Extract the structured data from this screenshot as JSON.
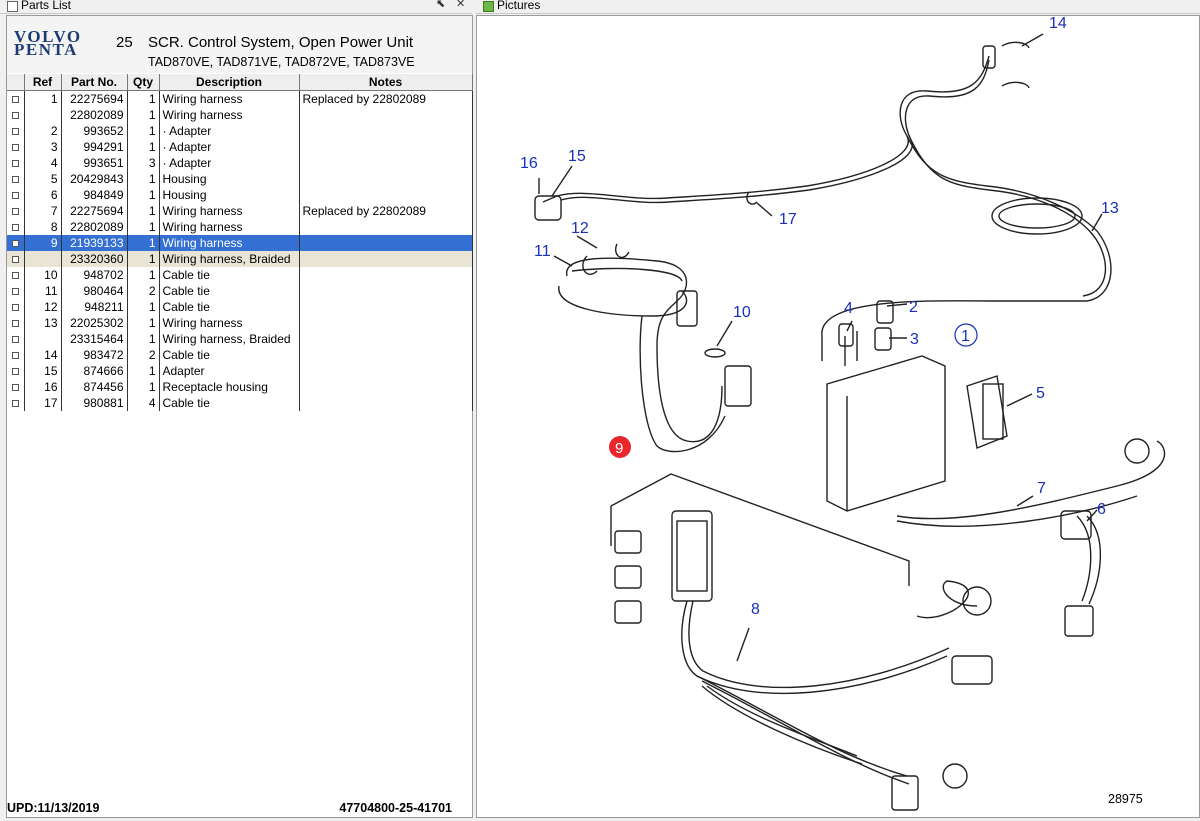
{
  "panes": {
    "left_title": "Parts List",
    "right_title": "Pictures",
    "pin_icon": "pin-icon",
    "close_icon": "close-icon"
  },
  "header": {
    "logo_line1": "VOLVO",
    "logo_line2": "PENTA",
    "group_no": "25",
    "group_title": "SCR. Control System, Open Power Unit",
    "engines": "TAD870VE, TAD871VE, TAD872VE, TAD873VE"
  },
  "table": {
    "columns": [
      "Ref",
      "Part No.",
      "Qty",
      "Description",
      "Notes"
    ],
    "rows": [
      {
        "ref": "1",
        "part": "22275694",
        "qty": "1",
        "desc": "Wiring harness",
        "notes": "Replaced by 22802089"
      },
      {
        "ref": "",
        "part": "22802089",
        "qty": "1",
        "desc": "Wiring harness",
        "notes": ""
      },
      {
        "ref": "2",
        "part": "993652",
        "qty": "1",
        "desc": "Adapter",
        "notes": ""
      },
      {
        "ref": "3",
        "part": "994291",
        "qty": "1",
        "desc": "Adapter",
        "notes": ""
      },
      {
        "ref": "4",
        "part": "993651",
        "qty": "3",
        "desc": "Adapter",
        "notes": ""
      },
      {
        "ref": "5",
        "part": "20429843",
        "qty": "1",
        "desc": "Housing",
        "notes": ""
      },
      {
        "ref": "6",
        "part": "984849",
        "qty": "1",
        "desc": "Housing",
        "notes": ""
      },
      {
        "ref": "7",
        "part": "22275694",
        "qty": "1",
        "desc": "Wiring harness",
        "notes": "Replaced by 22802089"
      },
      {
        "ref": "8",
        "part": "22802089",
        "qty": "1",
        "desc": "Wiring harness",
        "notes": ""
      },
      {
        "ref": "9",
        "part": "21939133",
        "qty": "1",
        "desc": "Wiring harness",
        "notes": ""
      },
      {
        "ref": "",
        "part": "23320360",
        "qty": "1",
        "desc": "Wiring harness, Braided",
        "notes": ""
      },
      {
        "ref": "10",
        "part": "948702",
        "qty": "1",
        "desc": "Cable tie",
        "notes": ""
      },
      {
        "ref": "11",
        "part": "980464",
        "qty": "2",
        "desc": "Cable tie",
        "notes": ""
      },
      {
        "ref": "12",
        "part": "948211",
        "qty": "1",
        "desc": "Cable tie",
        "notes": ""
      },
      {
        "ref": "13",
        "part": "22025302",
        "qty": "1",
        "desc": "Wiring harness",
        "notes": ""
      },
      {
        "ref": "",
        "part": "23315464",
        "qty": "1",
        "desc": "Wiring harness, Braided",
        "notes": ""
      },
      {
        "ref": "14",
        "part": "983472",
        "qty": "2",
        "desc": "Cable tie",
        "notes": ""
      },
      {
        "ref": "15",
        "part": "874666",
        "qty": "1",
        "desc": "Adapter",
        "notes": ""
      },
      {
        "ref": "16",
        "part": "874456",
        "qty": "1",
        "desc": "Receptacle housing",
        "notes": ""
      },
      {
        "ref": "17",
        "part": "980881",
        "qty": "4",
        "desc": "Cable tie",
        "notes": ""
      }
    ],
    "selected_row": 9,
    "sub_row": 10
  },
  "footer": {
    "upd": "UPD:11/13/2019",
    "id": "47704800-25-41701"
  },
  "picture": {
    "drawing_no": "28975",
    "callouts": {
      "c1": "1",
      "c2": "2",
      "c3": "3",
      "c4": "4",
      "c5": "5",
      "c6": "6",
      "c7": "7",
      "c8": "8",
      "c9": "9",
      "c10": "10",
      "c11": "11",
      "c12": "12",
      "c13": "13",
      "c14": "14",
      "c15": "15",
      "c16": "16",
      "c17": "17"
    },
    "highlight_color": "#e8262c",
    "callout_color": "#1a2fb8"
  },
  "colors": {
    "selection": "#3470d4",
    "sub_row": "#e8e4d6",
    "logo": "#1d3b73"
  }
}
